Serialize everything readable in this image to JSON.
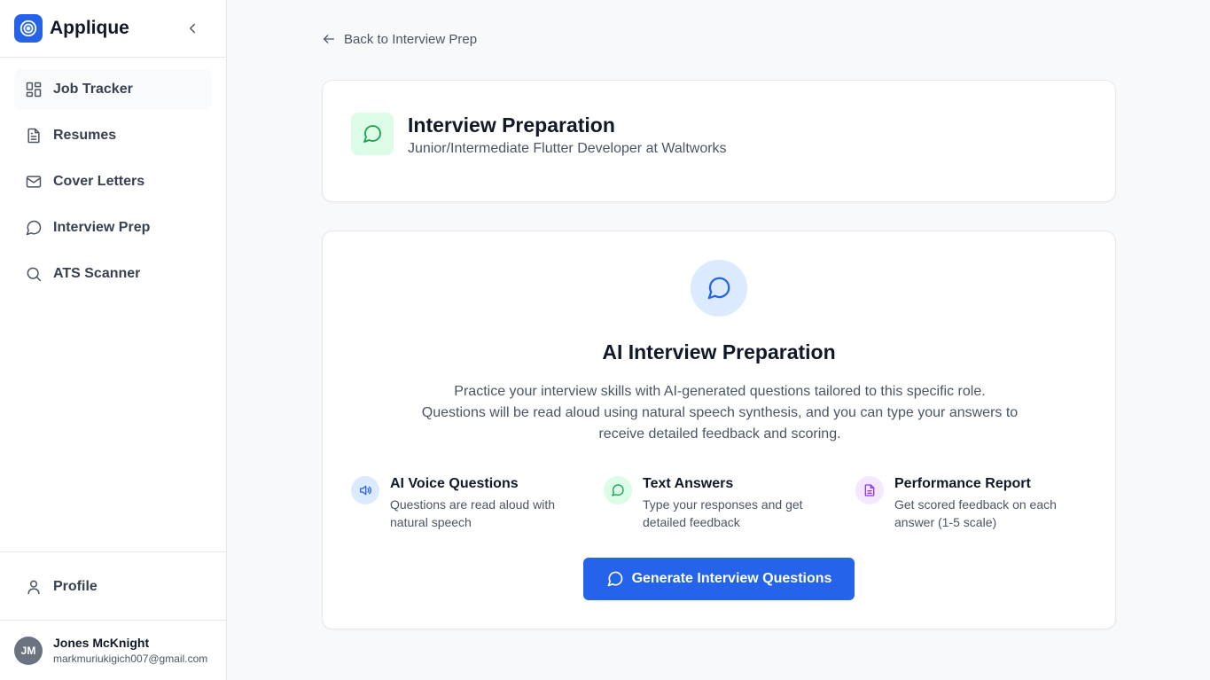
{
  "app": {
    "name": "Applique"
  },
  "sidebar": {
    "items": [
      {
        "label": "Job Tracker",
        "icon": "layout-grid-icon"
      },
      {
        "label": "Resumes",
        "icon": "file-text-icon"
      },
      {
        "label": "Cover Letters",
        "icon": "mail-icon"
      },
      {
        "label": "Interview Prep",
        "icon": "message-circle-icon"
      },
      {
        "label": "ATS Scanner",
        "icon": "search-icon"
      }
    ],
    "profile_label": "Profile"
  },
  "user": {
    "initials": "JM",
    "name": "Jones McKnight",
    "email": "markmuriukigich007@gmail.com"
  },
  "back_link": "Back to Interview Prep",
  "header": {
    "title": "Interview Preparation",
    "subtitle": "Junior/Intermediate Flutter Developer at Waltworks"
  },
  "main": {
    "title": "AI Interview Preparation",
    "desc_lines": [
      "Practice your interview skills with AI-generated questions tailored to this specific role.",
      "Questions will be read aloud using natural speech synthesis, and you can type your answers to",
      "receive detailed feedback and scoring."
    ],
    "features": [
      {
        "title": "AI Voice Questions",
        "desc_lines": [
          "Questions are read aloud with",
          "natural speech"
        ],
        "icon": "speaker-icon",
        "color": "#dbeafe"
      },
      {
        "title": "Text Answers",
        "desc_lines": [
          "Type your responses and get",
          "detailed feedback"
        ],
        "icon": "message-circle-icon",
        "color": "#dcfce7"
      },
      {
        "title": "Performance Report",
        "desc_lines": [
          "Get scored feedback on each",
          "answer (1-5 scale)"
        ],
        "icon": "file-text-icon",
        "color": "#f3e8ff"
      }
    ],
    "button_label": "Generate Interview Questions"
  },
  "colors": {
    "accent": "#2563eb",
    "green": "#16a34a",
    "purple": "#9333ea"
  }
}
